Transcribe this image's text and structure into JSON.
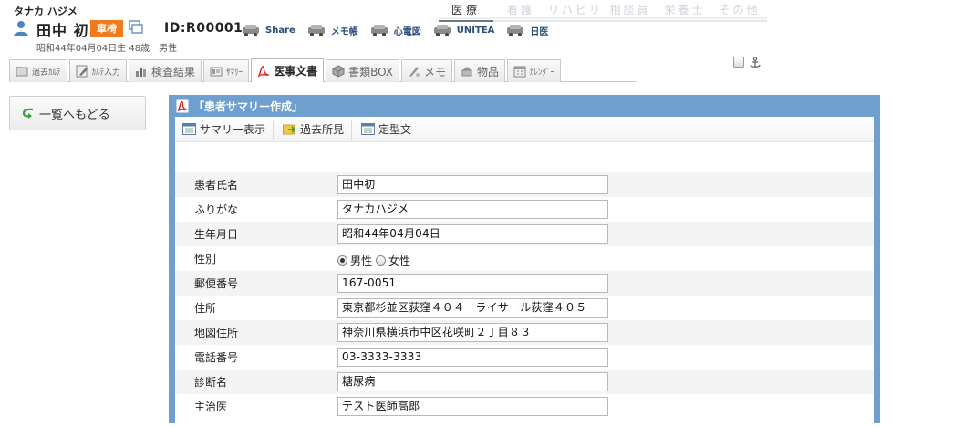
{
  "patient": {
    "kana": "タナカ ハジメ",
    "name": "田中 初",
    "badge": "車椅",
    "id": "ID:R00001",
    "info": "昭和44年04月04日生 48歳　男性"
  },
  "quick_links": [
    {
      "label": "Share",
      "icon": "car-icon"
    },
    {
      "label": "メモ帳",
      "icon": "car-icon"
    },
    {
      "label": "心電図",
      "icon": "car-icon"
    },
    {
      "label": "UNITEA",
      "icon": "car-icon"
    },
    {
      "label": "日医",
      "icon": "car-icon"
    }
  ],
  "categories": [
    {
      "label": "医療",
      "active": true
    },
    {
      "label": "看護",
      "active": false
    },
    {
      "label": "リハビリ",
      "active": false
    },
    {
      "label": "相談員",
      "active": false
    },
    {
      "label": "栄養士",
      "active": false
    },
    {
      "label": "その他",
      "active": false
    }
  ],
  "tabs": [
    {
      "label": "過去ｶﾙﾃ",
      "icon": "folder-icon",
      "active": false
    },
    {
      "label": "ｶﾙﾃ入力",
      "icon": "pencil-icon",
      "active": false
    },
    {
      "label": "検査結果",
      "icon": "bar-chart-icon",
      "active": false
    },
    {
      "label": "ｻﾏﾘｰ",
      "icon": "summary-icon",
      "active": false
    },
    {
      "label": "医事文書",
      "icon": "pdf-icon",
      "active": true
    },
    {
      "label": "書類BOX",
      "icon": "box-icon",
      "active": false
    },
    {
      "label": "メモ",
      "icon": "memo-icon",
      "active": false
    },
    {
      "label": "物品",
      "icon": "goods-icon",
      "active": false
    },
    {
      "label": "ｶﾚﾝﾀﾞｰ",
      "icon": "calendar-icon",
      "active": false
    }
  ],
  "back_button": "一覧へもどる",
  "panel": {
    "title": "「患者サマリー作成」",
    "toolbar": [
      "サマリー表示",
      "過去所見",
      "定型文"
    ]
  },
  "form": {
    "name_label": "患者氏名",
    "name_value": "田中初",
    "kana_label": "ふりがな",
    "kana_value": "タナカハジメ",
    "birth_label": "生年月日",
    "birth_value": "昭和44年04月04日",
    "sex_label": "性別",
    "sex_male": "男性",
    "sex_female": "女性",
    "sex_selected": "男性",
    "zip_label": "郵便番号",
    "zip_value": "167-0051",
    "address_label": "住所",
    "address_value": "東京都杉並区荻窪４０４　ライサール荻窪４０５",
    "map_address_label": "地図住所",
    "map_address_value": "神奈川県横浜市中区花咲町２丁目８３",
    "phone_label": "電話番号",
    "phone_value": "03-3333-3333",
    "diagnosis_label": "診断名",
    "diagnosis_value": "糖尿病",
    "doctor_label": "主治医",
    "doctor_value": "テスト医師高郎"
  },
  "colors": {
    "badge": "#f07a1e",
    "panel": "#6f9fcf",
    "link": "#2a4d7c"
  }
}
